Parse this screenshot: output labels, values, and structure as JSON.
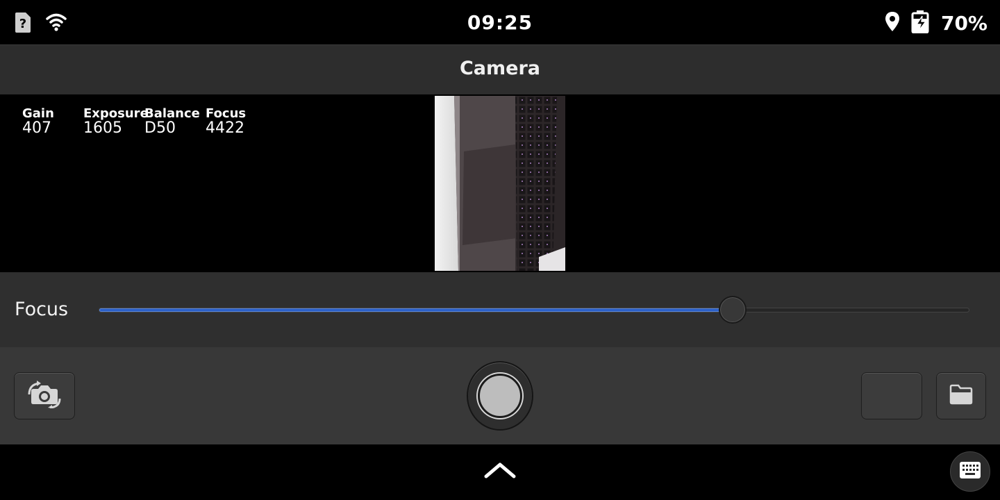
{
  "status_bar": {
    "time": "09:25",
    "battery_percent": "70%",
    "icons": [
      "sim-unknown-icon",
      "wifi-icon",
      "location-icon",
      "battery-charging-icon"
    ]
  },
  "header": {
    "title": "Camera"
  },
  "stats": [
    {
      "label": "Gain",
      "value": "407"
    },
    {
      "label": "Exposure",
      "value": "1605"
    },
    {
      "label": "Balance",
      "value": "D50"
    },
    {
      "label": "Focus",
      "value": "4422"
    }
  ],
  "focus_control": {
    "label": "Focus",
    "level": 0.728
  },
  "toolbar": {
    "icons": [
      "switch-camera-icon",
      "shutter-icon",
      "gallery-folder-icon"
    ]
  },
  "nav": {
    "icons": [
      "chevron-up-icon",
      "keyboard-icon"
    ]
  },
  "colors": {
    "accent": "#2a5fc7",
    "header_bg": "#2d2d2d",
    "toolbar_bg": "#383838",
    "panel_bg": "#2f2f2f"
  }
}
